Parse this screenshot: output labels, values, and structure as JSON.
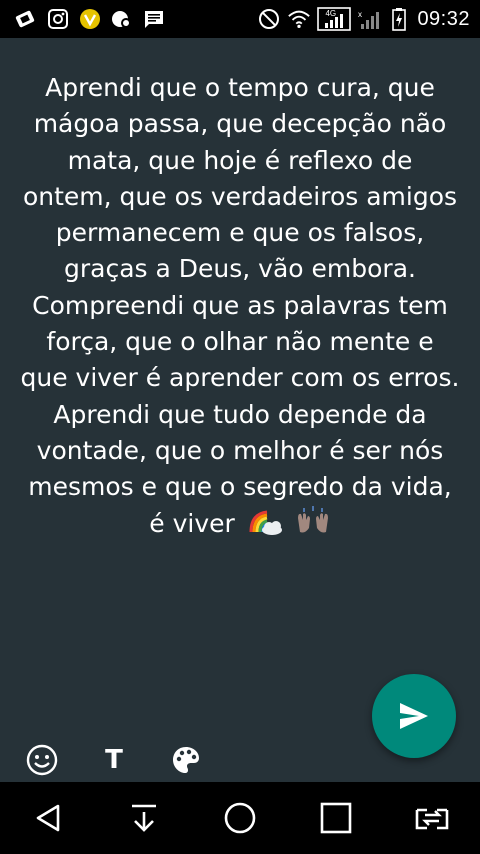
{
  "status_bar": {
    "time": "09:32",
    "network_label": "4G",
    "left_icons": [
      "screen-share-icon",
      "instagram-icon",
      "vivo-v-icon",
      "camera-cast-icon",
      "message-icon"
    ],
    "right_icons": [
      "dnd-icon",
      "wifi-icon",
      "signal-4g-icon",
      "signal-x-icon",
      "battery-charging-icon"
    ]
  },
  "composer": {
    "status_text": "Aprendi que o tempo cura, que mágoa passa, que decepção não mata, que hoje é reflexo de ontem, que os verdadeiros amigos permanecem e que os falsos, graças a Deus, vão embora. Compreendi que as palavras tem força, que o olhar não mente e que viver é aprender com os erros. Aprendi que tudo depende da vontade, que o melhor é ser nós mesmos e que o segredo da vida, é viver",
    "emojis": [
      "rainbow-cloud-emoji",
      "raised-hands-emoji"
    ],
    "text_tool_label": "T"
  },
  "colors": {
    "background": "#263238",
    "fab": "#00897b",
    "status_bar": "#000000",
    "nav_bar": "#000000"
  },
  "nav_bar": {
    "buttons": [
      "back-icon",
      "download-icon",
      "home-icon",
      "recents-icon",
      "switch-window-icon"
    ]
  }
}
